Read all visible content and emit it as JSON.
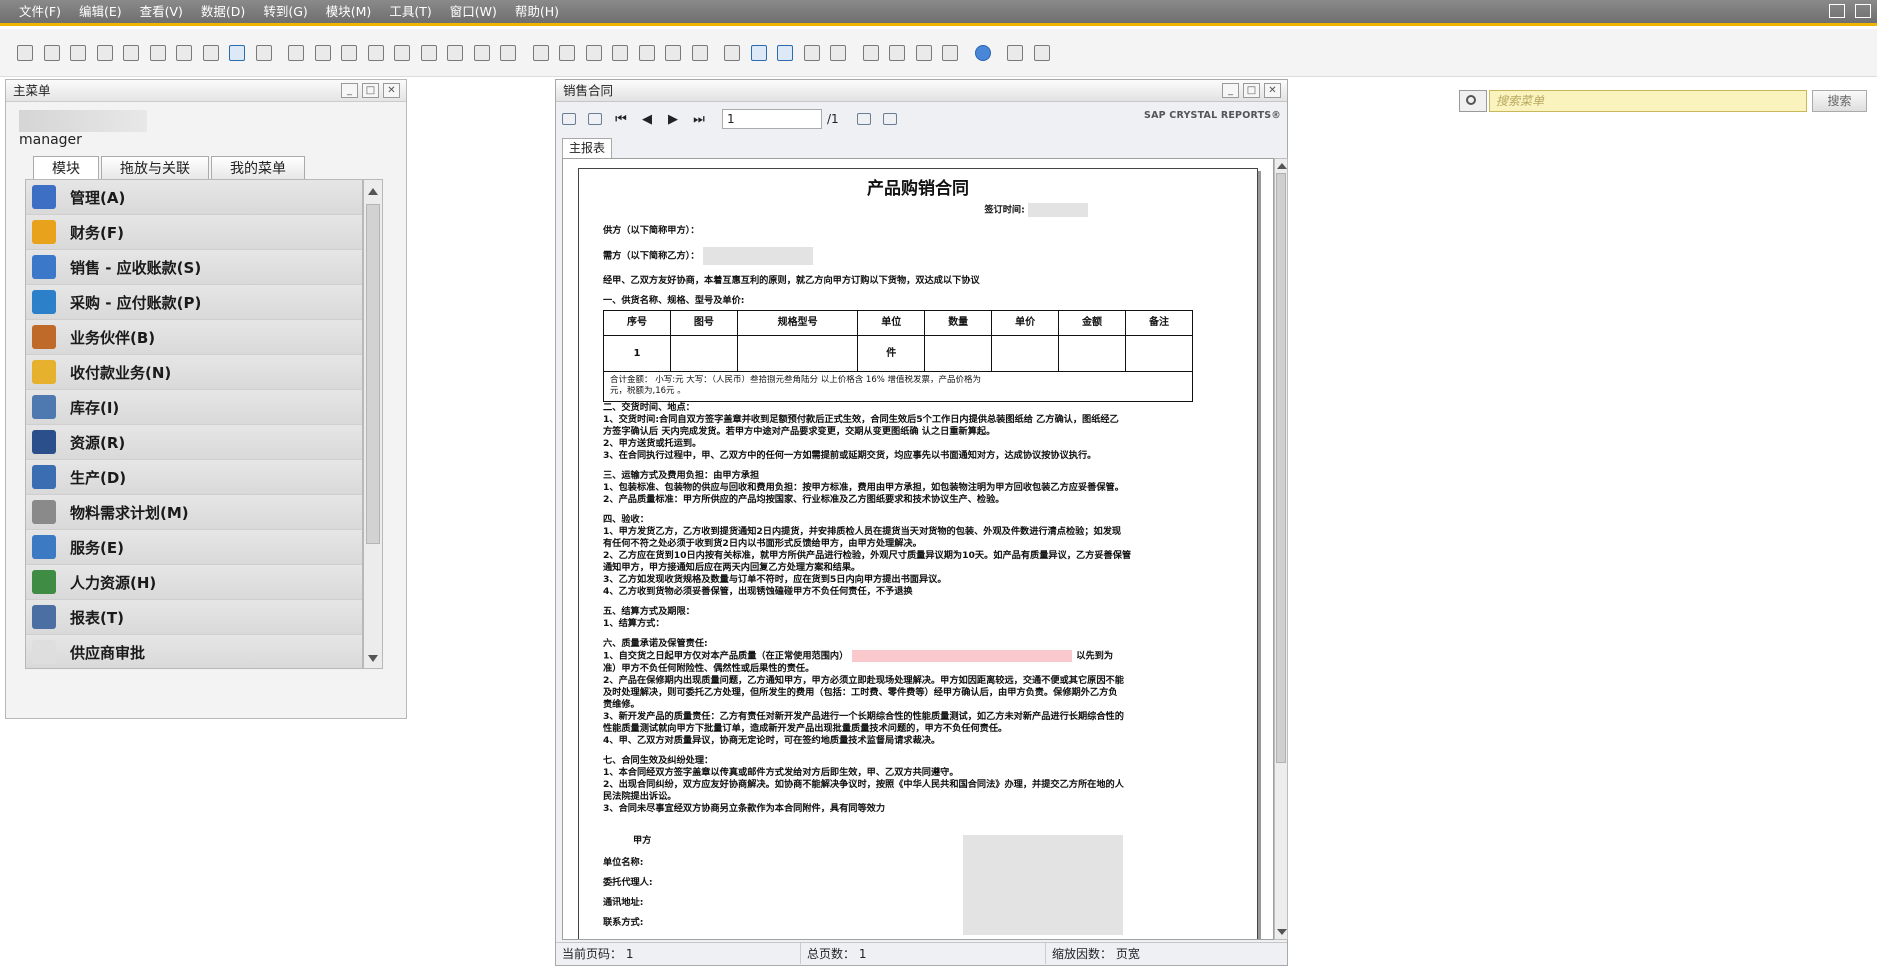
{
  "menubar": {
    "items": [
      "文件(F)",
      "编辑(E)",
      "查看(V)",
      "数据(D)",
      "转到(G)",
      "模块(M)",
      "工具(T)",
      "窗口(W)",
      "帮助(H)"
    ]
  },
  "main_menu": {
    "title": "主菜单",
    "username": "manager",
    "tabs": [
      "模块",
      "拖放与关联",
      "我的菜单"
    ],
    "items": [
      {
        "label": "管理(A)",
        "icon": "admin-icon",
        "color": "#3d6fc5"
      },
      {
        "label": "财务(F)",
        "icon": "pie-chart-icon",
        "color": "#e8a21c"
      },
      {
        "label": "销售 - 应收账款(S)",
        "icon": "sales-tag-icon",
        "color": "#3b78c9"
      },
      {
        "label": "采购 - 应付账款(P)",
        "icon": "cart-icon",
        "color": "#2c7fc9"
      },
      {
        "label": "业务伙伴(B)",
        "icon": "partners-icon",
        "color": "#c06a2a"
      },
      {
        "label": "收付款业务(N)",
        "icon": "money-icon",
        "color": "#e6b12d"
      },
      {
        "label": "库存(I)",
        "icon": "inventory-icon",
        "color": "#4d78b0"
      },
      {
        "label": "资源(R)",
        "icon": "factory-icon",
        "color": "#2b4f8a"
      },
      {
        "label": "生产(D)",
        "icon": "production-icon",
        "color": "#3b6db3"
      },
      {
        "label": "物料需求计划(M)",
        "icon": "mrp-icon",
        "color": "#8a8a8a"
      },
      {
        "label": "服务(E)",
        "icon": "service-icon",
        "color": "#3c7ac4"
      },
      {
        "label": "人力资源(H)",
        "icon": "hr-icon",
        "color": "#3f8c45"
      },
      {
        "label": "报表(T)",
        "icon": "report-icon",
        "color": "#4b6ea3"
      },
      {
        "label": "供应商审批",
        "icon": "",
        "color": "#dedede"
      }
    ]
  },
  "contract_window": {
    "title": "销售合同",
    "page_value": "1",
    "page_total": "/1",
    "brand": "SAP CRYSTAL REPORTS®",
    "tab_label": "主报表",
    "status": {
      "current_page": "当前页码： 1",
      "total_pages": "总页数： 1",
      "zoom": "缩放因数： 页宽"
    }
  },
  "document": {
    "title": "产品购销合同",
    "sign_time": "签订时间:",
    "supplier": "供方（以下简称甲方）：",
    "buyer": "需方（以下简称乙方）：",
    "intro": "经甲、乙双方友好协商，本着互惠互利的原则，就乙方向甲方订购以下货物，双达成以下协议",
    "sec1": "一、供货名称、规格、型号及单价:",
    "table_headers": [
      "序号",
      "图号",
      "规格型号",
      "单位",
      "数量",
      "单价",
      "金额",
      "备注"
    ],
    "table_row": [
      "1",
      "",
      "",
      "件",
      "",
      "",
      "",
      ""
    ],
    "total_line1": "合计金额：  小写:元              大写：（人民币）叁拾捌元叁角陆分                       以上价格含 16% 增值税发票，产品价格为",
    "total_line2": "元，税额为,16元 。",
    "sec2": "二、交货时间、地点：",
    "sec2_lines": [
      "1、交货时间:合同自双方签字盖章并收到足额预付款后正式生效，合同生效后5个工作日内提供总装图纸给     乙方确认，图纸经乙",
      "方签字确认后       天内完成发货。若甲方中途对产品要求变更，交期从变更图纸确       认之日重新算起。",
      "2、甲方送货或托运到。",
      "3、在合同执行过程中，甲、乙双方中的任何一方如需提前或延期交货，均应事先以书面通知对方，达成协议按协议执行。"
    ],
    "sec3": "三、运输方式及费用负担：由甲方承担",
    "sec3_lines": [
      "1、包装标准、包装物的供应与回收和费用负担：按甲方标准，费用由甲方承担，如包装物注明为甲方回收包装乙方应妥善保管。",
      "2、产品质量标准：甲方所供应的产品均按国家、行业标准及乙方图纸要求和技术协议生产、检验。"
    ],
    "sec4": "四、验收：",
    "sec4_lines": [
      "1、甲方发货乙方，乙方收到提货通知2日内提货，并安排质检人员在提货当天对货物的包装、外观及件数进行清点检验；如发现",
      "有任何不符之处必须于收到货2日内以书面形式反馈给甲方，由甲方处理解决。",
      "2、乙方应在货到10日内按有关标准，就甲方所供产品进行检验，外观尺寸质量异议期为10天。如产品有质量异议，乙方妥善保管",
      "通知甲方，甲方接通知后应在两天内回复乙方处理方案和结果。",
      "3、乙方如发现收货规格及数量与订单不符时，应在货到5日内向甲方提出书面异议。",
      "4、乙方收到货物必须妥善保管，出现锈蚀磕碰甲方不负任何责任，不予退换"
    ],
    "sec5": "五、结算方式及期限：",
    "sec5_lines": [
      "1、结算方式："
    ],
    "sec6": "六、质量承诺及保管责任:",
    "sec6_lines": [
      "1、自交货之日起甲方仅对本产品质量（在正常使用范围内）",
      "准）甲方不负任何附险性、偶然性或后果性的责任。",
      "2、产品在保修期内出现质量问题，乙方通知甲方，甲方必须立即赴现场处理解决。甲方如因距离较远，交通不便或其它原因不能",
      "及时处理解决，则可委托乙方处理，但所发生的费用（包括：工时费、零件费等）经甲方确认后，由甲方负责。保修期外乙方负",
      "责维修。",
      "3、新开发产品的质量责任：乙方有责任对新开发产品进行一个长期综合性的性能质量测试，如乙方未对新产品进行长期综合性的",
      "性能质量测试就向甲方下批量订单，造成新开发产品出现批量质量技术问题的，甲方不负任何责任。",
      "4、甲、乙双方对质量异议，协商无定论时，可在签约地质量技术监督局请求裁决。"
    ],
    "sec6_tail": "以先到为",
    "sec7": "七、合同生效及纠纷处理：",
    "sec7_lines": [
      "1、本合同经双方签字盖章以传真或邮件方式发给对方后即生效，甲、乙双方共同遵守。",
      "2、出现合同纠纷，双方应友好协商解决。如协商不能解决争议时，按照《中华人民共和国合同法》办理，并提交乙方所在地的人",
      "民法院提出诉讼。",
      "3、合同未尽事宜经双方协商另立条款作为本合同附件，具有同等效力"
    ],
    "party_a": "甲方",
    "unit_name": "单位名称:",
    "agent": "委托代理人:",
    "address": "通讯地址:",
    "contact": "联系方式:"
  },
  "search": {
    "placeholder": "搜索菜单",
    "button": "搜索"
  }
}
